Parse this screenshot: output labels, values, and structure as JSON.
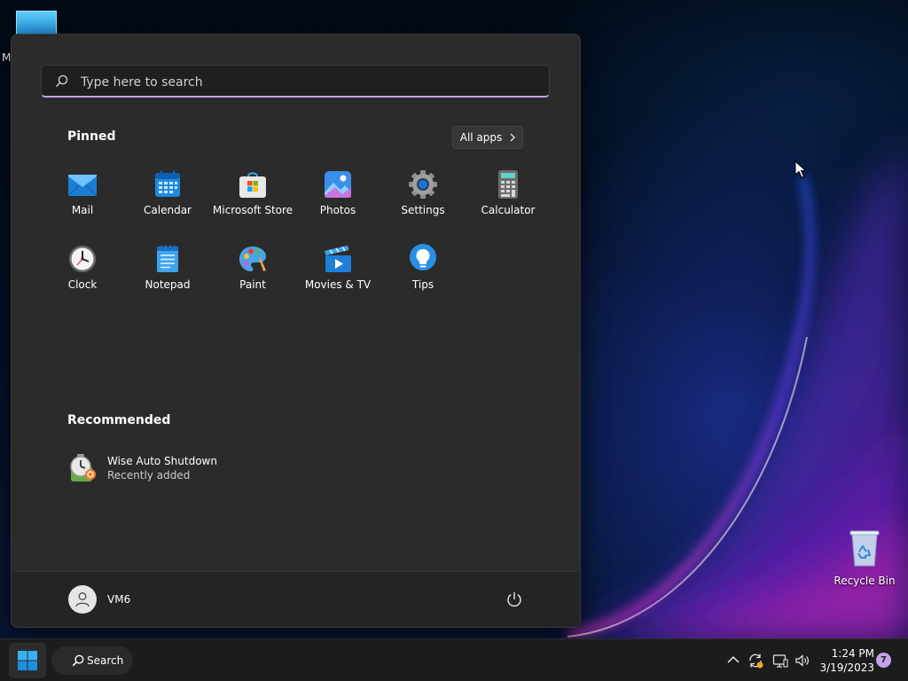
{
  "desktop": {
    "top_icon_label": "M",
    "recycle_bin_label": "Recycle Bin"
  },
  "start_menu": {
    "search_placeholder": "Type here to search",
    "pinned_title": "Pinned",
    "all_apps_label": "All apps",
    "pinned_apps": [
      {
        "label": "Mail",
        "icon": "mail-icon"
      },
      {
        "label": "Calendar",
        "icon": "calendar-icon"
      },
      {
        "label": "Microsoft Store",
        "icon": "store-icon"
      },
      {
        "label": "Photos",
        "icon": "photos-icon"
      },
      {
        "label": "Settings",
        "icon": "gear-icon"
      },
      {
        "label": "Calculator",
        "icon": "calculator-icon"
      },
      {
        "label": "Clock",
        "icon": "clock-icon"
      },
      {
        "label": "Notepad",
        "icon": "notepad-icon"
      },
      {
        "label": "Paint",
        "icon": "palette-icon"
      },
      {
        "label": "Movies & TV",
        "icon": "film-icon"
      },
      {
        "label": "Tips",
        "icon": "lightbulb-icon"
      }
    ],
    "recommended_title": "Recommended",
    "recommended": [
      {
        "name": "Wise Auto Shutdown",
        "subtitle": "Recently added"
      }
    ],
    "user_name": "VM6"
  },
  "taskbar": {
    "search_label": "Search",
    "time": "1:24 PM",
    "date": "3/19/2023",
    "notification_count": "7"
  },
  "colors": {
    "accent": "#c8a0e6",
    "windows_blue": "#2aa7f0",
    "menu_bg": "#2b2b2b"
  }
}
